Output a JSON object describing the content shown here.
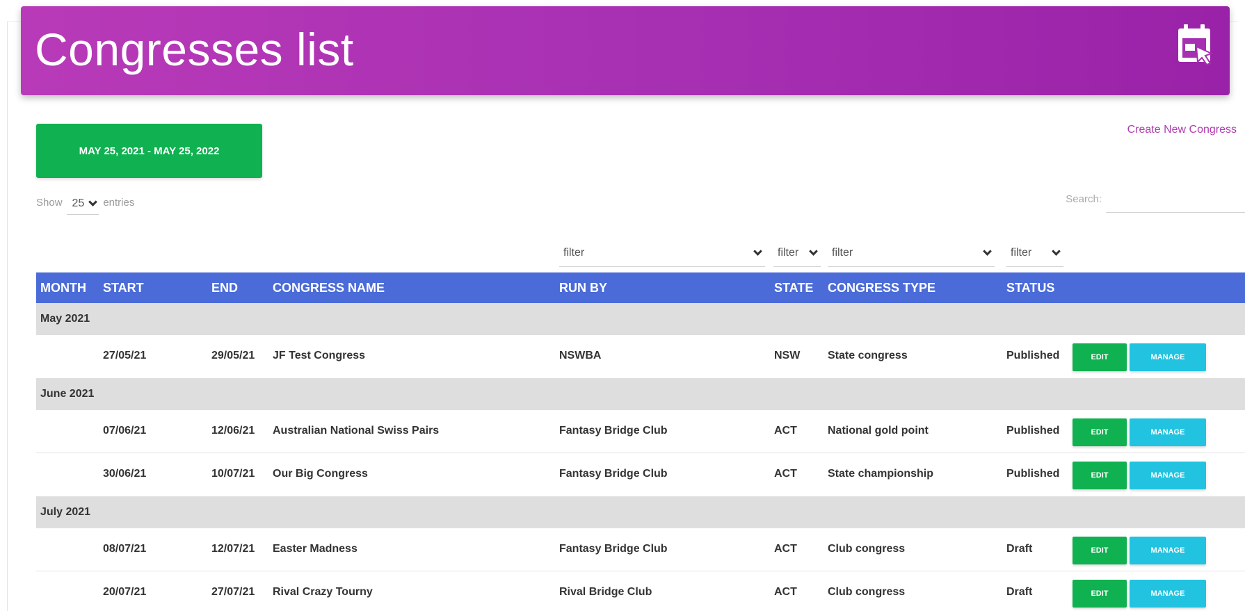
{
  "header": {
    "title": "Congresses list",
    "icon": "calendar-cursor-icon"
  },
  "date_range_button": "MAY 25, 2021 - MAY 25, 2022",
  "create_link": "Create New Congress",
  "entries": {
    "show_label": "Show",
    "page_size": "25",
    "entries_label": "entries"
  },
  "search": {
    "label": "Search:",
    "value": ""
  },
  "filters": {
    "run_by": "filter",
    "state": "filter",
    "congress_type": "filter",
    "status": "filter"
  },
  "columns": {
    "month": "MONTH",
    "start": "START",
    "end": "END",
    "name": "CONGRESS NAME",
    "run_by": "RUN BY",
    "state": "STATE",
    "type": "CONGRESS TYPE",
    "status": "STATUS"
  },
  "buttons": {
    "edit": "EDIT",
    "manage": "MANAGE"
  },
  "groups": [
    {
      "month": "May 2021",
      "rows": [
        {
          "start": "27/05/21",
          "end": "29/05/21",
          "name": "JF Test Congress",
          "run_by": "NSWBA",
          "state": "NSW",
          "type": "State congress",
          "status": "Published"
        }
      ]
    },
    {
      "month": "June 2021",
      "rows": [
        {
          "start": "07/06/21",
          "end": "12/06/21",
          "name": "Australian National Swiss Pairs",
          "run_by": "Fantasy Bridge Club",
          "state": "ACT",
          "type": "National gold point",
          "status": "Published"
        },
        {
          "start": "30/06/21",
          "end": "10/07/21",
          "name": "Our Big Congress",
          "run_by": "Fantasy Bridge Club",
          "state": "ACT",
          "type": "State championship",
          "status": "Published"
        }
      ]
    },
    {
      "month": "July 2021",
      "rows": [
        {
          "start": "08/07/21",
          "end": "12/07/21",
          "name": "Easter Madness",
          "run_by": "Fantasy Bridge Club",
          "state": "ACT",
          "type": "Club congress",
          "status": "Draft"
        },
        {
          "start": "20/07/21",
          "end": "27/07/21",
          "name": "Rival Crazy Tourny",
          "run_by": "Rival Bridge Club",
          "state": "ACT",
          "type": "Club congress",
          "status": "Draft"
        }
      ]
    }
  ],
  "colors": {
    "header": "#a62fb2",
    "table_header": "#4a6bd8",
    "edit": "#10b150",
    "manage": "#21c3e0"
  }
}
